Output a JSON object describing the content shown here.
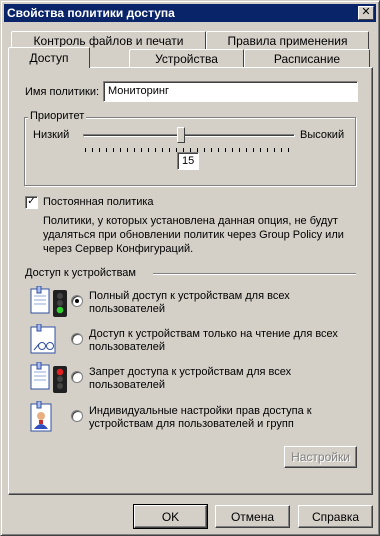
{
  "window": {
    "title": "Свойства политики доступа",
    "close_glyph": "✕"
  },
  "tabs": {
    "row_back": [
      "Контроль файлов и печати",
      "Правила применения"
    ],
    "row_front": [
      "Доступ",
      "Устройства",
      "Расписание"
    ],
    "active": "Доступ"
  },
  "policy_name": {
    "label": "Имя политики:",
    "value": "Мониторинг"
  },
  "priority": {
    "group_label": "Приоритет",
    "low_label": "Низкий",
    "high_label": "Высокий",
    "value": "15",
    "slider_fraction": 0.45
  },
  "persistent": {
    "checked": true,
    "check_glyph": "✓",
    "label": "Постоянная политика",
    "description_line1": "Политики, у которых установлена данная опция, не будут",
    "description_line2": "удаляться при обновлении политик через Group Policy или",
    "description_line3": "через Сервер Конфигураций."
  },
  "device_access": {
    "section_label": "Доступ к устройствам",
    "options": [
      {
        "line1": "Полный доступ к устройствам для всех",
        "line2": "пользователей",
        "selected": true,
        "icon": "full-access-traffic-light-green-icon"
      },
      {
        "line1": "Доступ к устройствам только на чтение для всех",
        "line2": "пользователей",
        "selected": false,
        "icon": "read-only-glasses-icon"
      },
      {
        "line1": "Запрет доступа к устройствам для всех",
        "line2": "пользователей",
        "selected": false,
        "icon": "deny-traffic-light-red-icon"
      },
      {
        "line1": "Индивидуальные настройки прав доступа к",
        "line2": "устройствам для пользователей и групп",
        "selected": false,
        "icon": "user-card-icon"
      }
    ],
    "settings_button": "Настройки"
  },
  "footer": {
    "ok": "OK",
    "cancel": "Отмена",
    "help": "Справка"
  }
}
